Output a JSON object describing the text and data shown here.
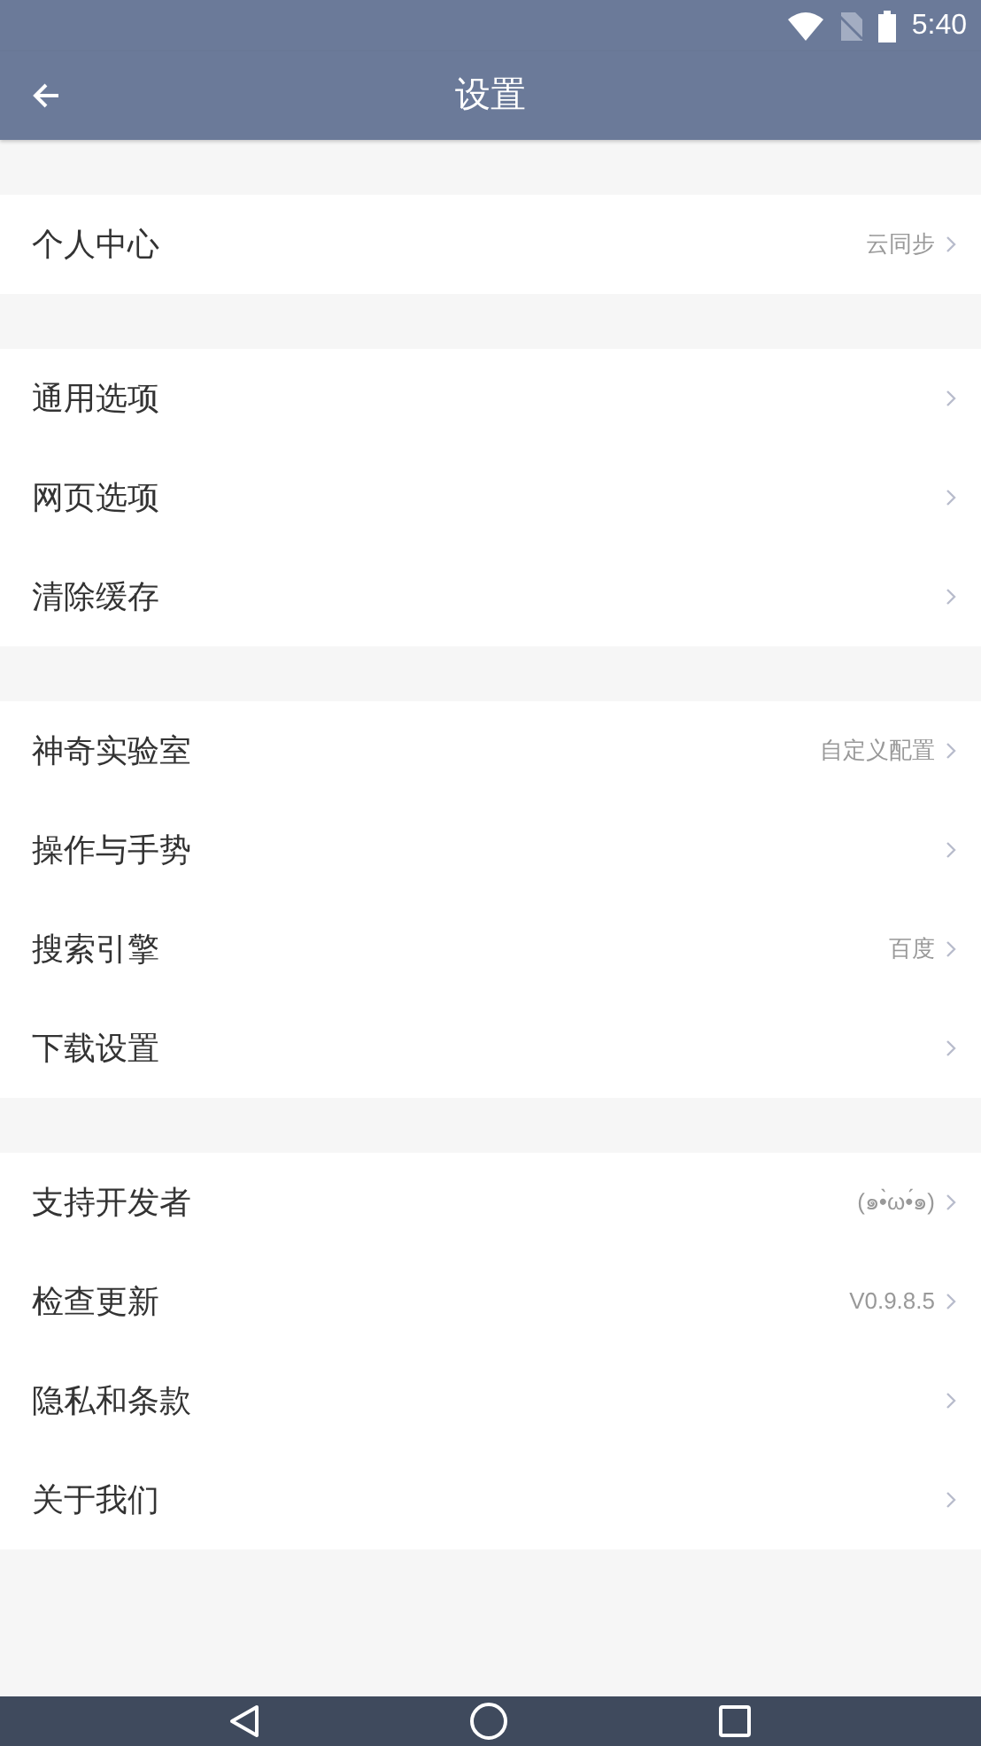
{
  "status_bar": {
    "time": "5:40"
  },
  "toolbar": {
    "title": "设置"
  },
  "groups": [
    {
      "items": [
        {
          "label": "个人中心",
          "value": "云同步"
        }
      ]
    },
    {
      "items": [
        {
          "label": "通用选项"
        },
        {
          "label": "网页选项"
        },
        {
          "label": "清除缓存"
        }
      ]
    },
    {
      "items": [
        {
          "label": "神奇实验室",
          "value": "自定义配置"
        },
        {
          "label": "操作与手势"
        },
        {
          "label": "搜索引擎",
          "value": "百度"
        },
        {
          "label": "下载设置"
        }
      ]
    },
    {
      "items": [
        {
          "label": "支持开发者",
          "value": "(๑•̀ω•́๑)"
        },
        {
          "label": "检查更新",
          "value": "V0.9.8.5"
        },
        {
          "label": "隐私和条款"
        },
        {
          "label": "关于我们"
        }
      ]
    }
  ]
}
